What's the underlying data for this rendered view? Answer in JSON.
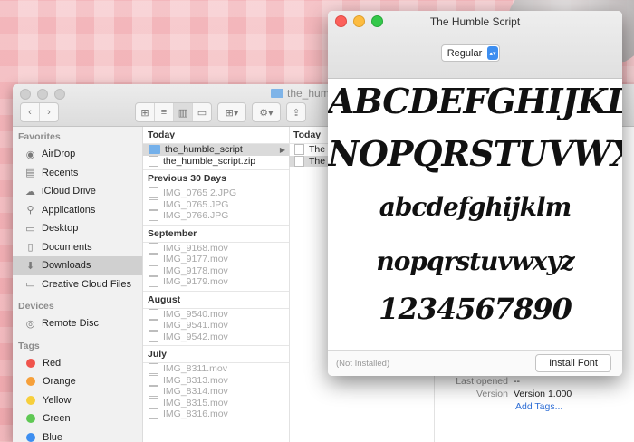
{
  "finder": {
    "title": "the_humble_script",
    "sidebar": {
      "favorites_heading": "Favorites",
      "favorites": [
        {
          "label": "AirDrop",
          "icon": "airdrop-icon",
          "glyph": "◉"
        },
        {
          "label": "Recents",
          "icon": "recents-icon",
          "glyph": "▤"
        },
        {
          "label": "iCloud Drive",
          "icon": "cloud-icon",
          "glyph": "☁"
        },
        {
          "label": "Applications",
          "icon": "applications-icon",
          "glyph": "⚲"
        },
        {
          "label": "Desktop",
          "icon": "desktop-icon",
          "glyph": "▭"
        },
        {
          "label": "Documents",
          "icon": "documents-icon",
          "glyph": "▯"
        },
        {
          "label": "Downloads",
          "icon": "downloads-icon",
          "glyph": "⬇"
        },
        {
          "label": "Creative Cloud Files",
          "icon": "folder-icon",
          "glyph": "▭"
        }
      ],
      "devices_heading": "Devices",
      "devices": [
        {
          "label": "Remote Disc",
          "icon": "disc-icon",
          "glyph": "◎"
        }
      ],
      "tags_heading": "Tags",
      "tags": [
        {
          "label": "Red",
          "color": "#f0544c"
        },
        {
          "label": "Orange",
          "color": "#f6a03a"
        },
        {
          "label": "Yellow",
          "color": "#f7cf3c"
        },
        {
          "label": "Green",
          "color": "#5fc854"
        },
        {
          "label": "Blue",
          "color": "#3d8ef0"
        }
      ]
    },
    "column1": {
      "today_heading": "Today",
      "today": [
        "the_humble_script",
        "the_humble_script.zip"
      ],
      "prev30_heading": "Previous 30 Days",
      "prev30": [
        "IMG_0765 2.JPG",
        "IMG_0765.JPG",
        "IMG_0766.JPG"
      ],
      "september_heading": "September",
      "september": [
        "IMG_9168.mov",
        "IMG_9177.mov",
        "IMG_9178.mov",
        "IMG_9179.mov"
      ],
      "august_heading": "August",
      "august": [
        "IMG_9540.mov",
        "IMG_9541.mov",
        "IMG_9542.mov"
      ],
      "july_heading": "July",
      "july": [
        "IMG_8311.mov",
        "IMG_8313.mov",
        "IMG_8314.mov",
        "IMG_8315.mov",
        "IMG_8316.mov"
      ]
    },
    "column2": {
      "today_heading": "Today",
      "items": [
        "The H",
        "The H"
      ]
    },
    "info": {
      "last_opened_label": "Last opened",
      "last_opened_value": "--",
      "version_label": "Version",
      "version_value": "Version 1.000",
      "add_tags": "Add Tags..."
    }
  },
  "font_window": {
    "title": "The Humble Script",
    "style_select": "Regular",
    "samples": {
      "upper1": "ABCDEFGHIJKLM",
      "upper2": "NOPQRSTUVWXYZ",
      "lower1": "abcdefghijklm",
      "lower2": "nopqrstuvwxyz",
      "digits": "1234567890"
    },
    "status": "(Not Installed)",
    "install_button": "Install Font"
  }
}
